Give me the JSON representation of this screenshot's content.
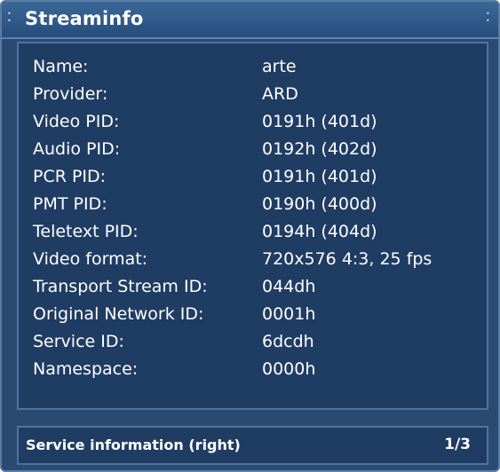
{
  "window": {
    "title": "Streaminfo"
  },
  "info": {
    "rows": [
      {
        "label": "Name:",
        "value": "arte"
      },
      {
        "label": "Provider:",
        "value": "ARD"
      },
      {
        "label": "Video PID:",
        "value": "0191h  (401d)"
      },
      {
        "label": "Audio PID:",
        "value": "0192h  (402d)"
      },
      {
        "label": "PCR PID:",
        "value": "0191h  (401d)"
      },
      {
        "label": "PMT PID:",
        "value": "0190h  (400d)"
      },
      {
        "label": "Teletext PID:",
        "value": "0194h  (404d)"
      },
      {
        "label": "Video format:",
        "value": "720x576 4:3, 25 fps"
      },
      {
        "label": "Transport Stream ID:",
        "value": "044dh"
      },
      {
        "label": "Original Network ID:",
        "value": "0001h"
      },
      {
        "label": "Service ID:",
        "value": "6dcdh"
      },
      {
        "label": "Namespace:",
        "value": "0000h"
      }
    ]
  },
  "status": {
    "text": "Service information (right)",
    "page": "1/3"
  },
  "colors": {
    "background": "#2a4a72",
    "panel": "#1f3c63",
    "border": "#4e73a0",
    "text": "#ffffff"
  }
}
